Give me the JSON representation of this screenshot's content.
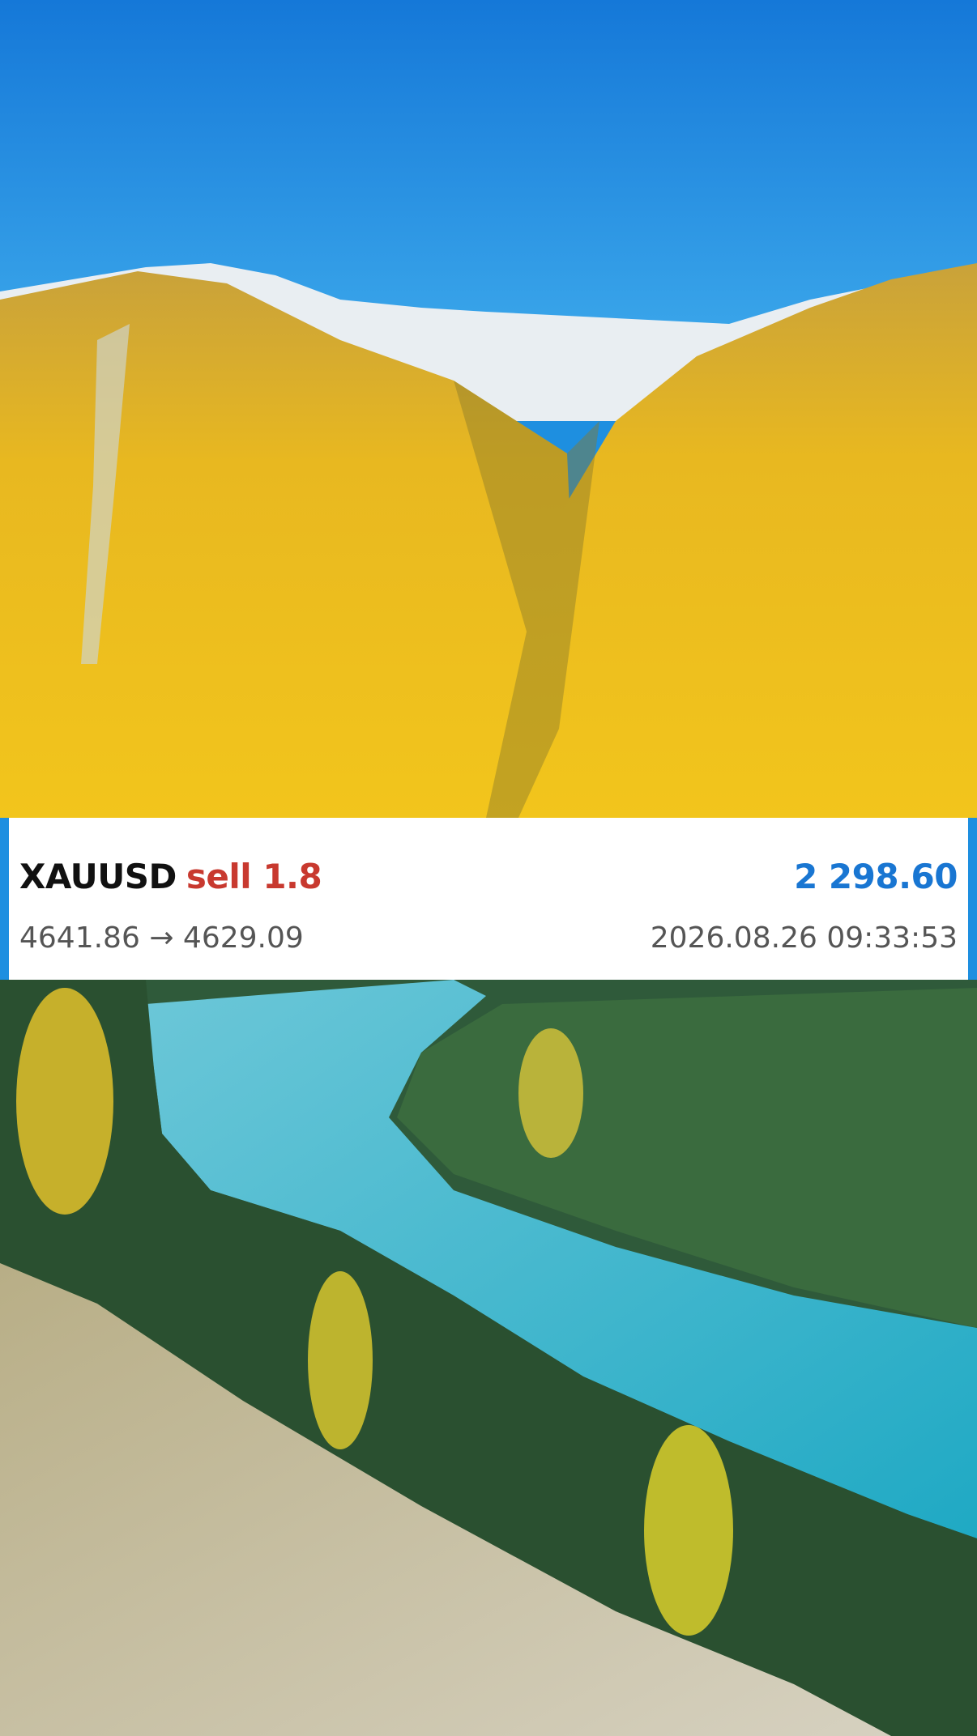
{
  "trade": {
    "symbol": "XAUUSD",
    "side_volume": "sell 1.8",
    "profit": "2 298.60",
    "prices": "4641.86 → 4629.09",
    "timestamp": "2026.08.26 09:33:53"
  },
  "colors": {
    "sell": "#c8392f",
    "profit": "#1976d2",
    "sky": "#1e8fe0",
    "larch": "#e8b820",
    "river": "#2fb3c8"
  }
}
